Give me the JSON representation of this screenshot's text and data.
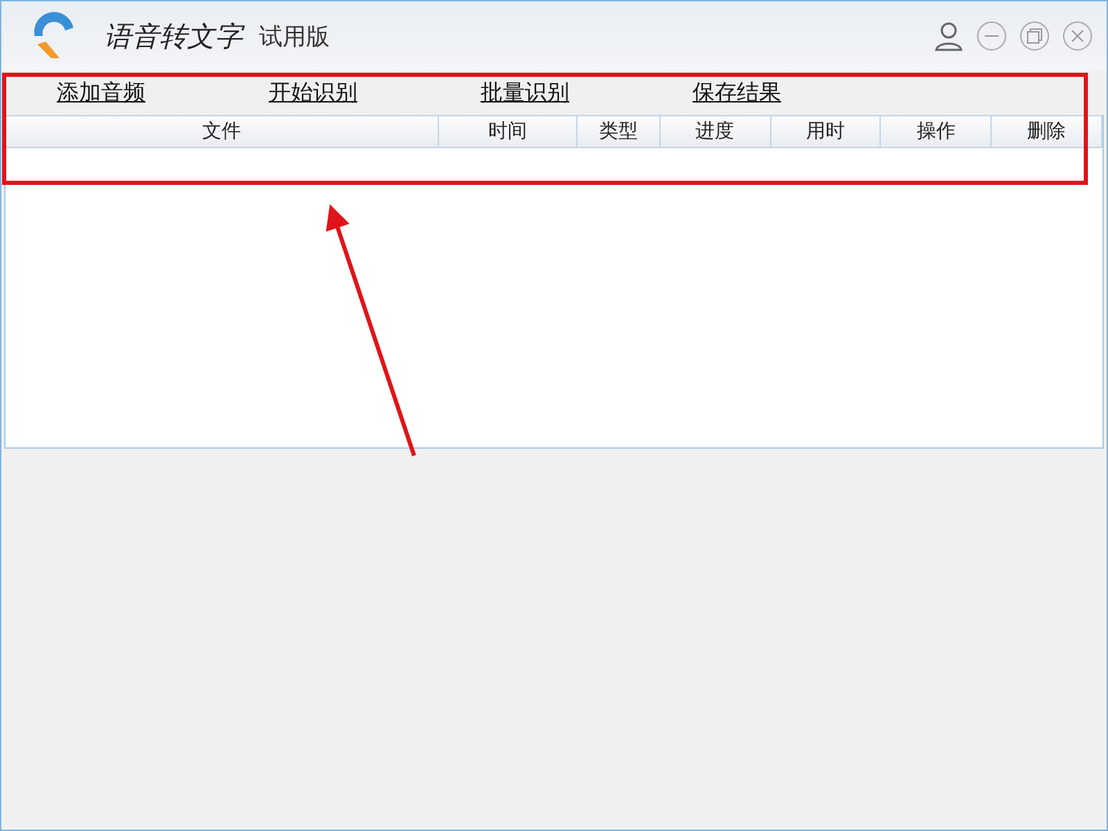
{
  "window": {
    "title": "语音转文字",
    "edition": "试用版"
  },
  "toolbar": [
    "添加音频",
    "开始识别",
    "批量识别",
    "保存结果"
  ],
  "table": {
    "columns": [
      "文件",
      "时间",
      "类型",
      "进度",
      "用时",
      "操作",
      "删除"
    ]
  },
  "annotation": {
    "kind": "box-arrow"
  }
}
